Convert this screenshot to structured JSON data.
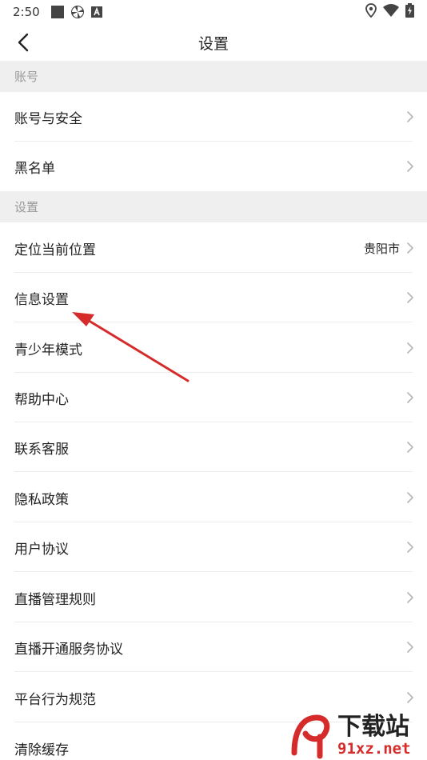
{
  "status_bar": {
    "time": "2:50",
    "icons": [
      "square-icon",
      "pinwheel-icon",
      "a-badge-icon"
    ],
    "right_icons": [
      "location-icon",
      "wifi-icon",
      "battery-icon"
    ]
  },
  "header": {
    "title": "设置"
  },
  "sections": [
    {
      "title": "账号",
      "items": [
        {
          "label": "账号与安全",
          "value": ""
        },
        {
          "label": "黑名单",
          "value": ""
        }
      ]
    },
    {
      "title": "设置",
      "items": [
        {
          "label": "定位当前位置",
          "value": "贵阳市"
        },
        {
          "label": "信息设置",
          "value": ""
        },
        {
          "label": "青少年模式",
          "value": ""
        },
        {
          "label": "帮助中心",
          "value": ""
        },
        {
          "label": "联系客服",
          "value": ""
        },
        {
          "label": "隐私政策",
          "value": ""
        },
        {
          "label": "用户协议",
          "value": ""
        },
        {
          "label": "直播管理规则",
          "value": ""
        },
        {
          "label": "直播开通服务协议",
          "value": ""
        },
        {
          "label": "平台行为规范",
          "value": ""
        },
        {
          "label": "清除缓存",
          "value": ""
        }
      ]
    }
  ],
  "colors": {
    "section_bg": "#efefef",
    "section_text": "#9a9a9a",
    "annotation_arrow": "#d62b2b"
  },
  "watermark": {
    "top": "下载站",
    "bottom": "91xz.net"
  }
}
